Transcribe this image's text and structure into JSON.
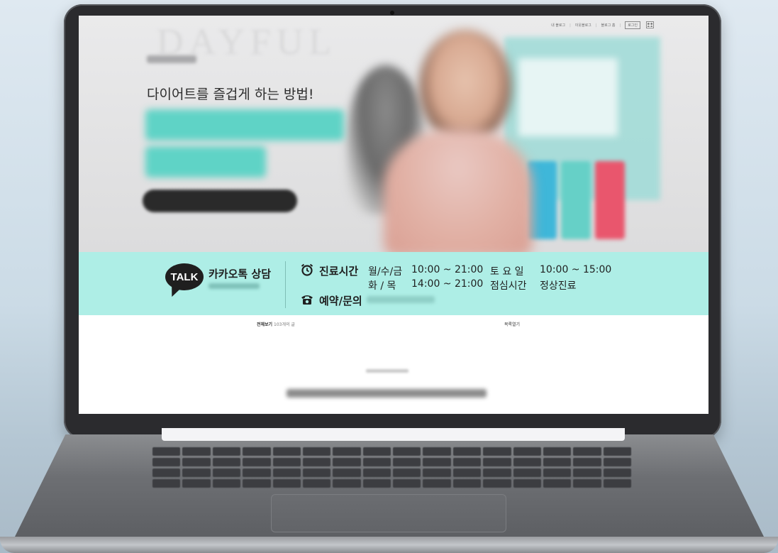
{
  "blog": {
    "top_links": [
      "내 블로그",
      "이웃블로그",
      "블로그 홈",
      "로그인"
    ]
  },
  "hero": {
    "headline": "다이어트를 즐겁게 하는 방법!"
  },
  "info_band": {
    "talk_badge": "TALK",
    "kakao_title": "카카오톡 상담",
    "hours_label": "진료시간",
    "row1_days": "월/수/금",
    "row1_time": "10:00 ~ 21:00",
    "row1_days2": "토 요 일",
    "row1_time2": "10:00 ~ 15:00",
    "row2_days": "화  /  목",
    "row2_time": "14:00 ~ 21:00",
    "row2_days2": "점심시간",
    "row2_time2": "정상진료",
    "inquiry_label": "예약/문의"
  },
  "post_list": {
    "view_all": "전체보기",
    "count": "103개의 글",
    "toggle_list": "목록열기"
  },
  "colors": {
    "band_bg": "#aeeee6",
    "accent_teal": "#5fd3c6"
  },
  "icons": [
    "clock-icon",
    "phone-icon",
    "grid-icon"
  ]
}
